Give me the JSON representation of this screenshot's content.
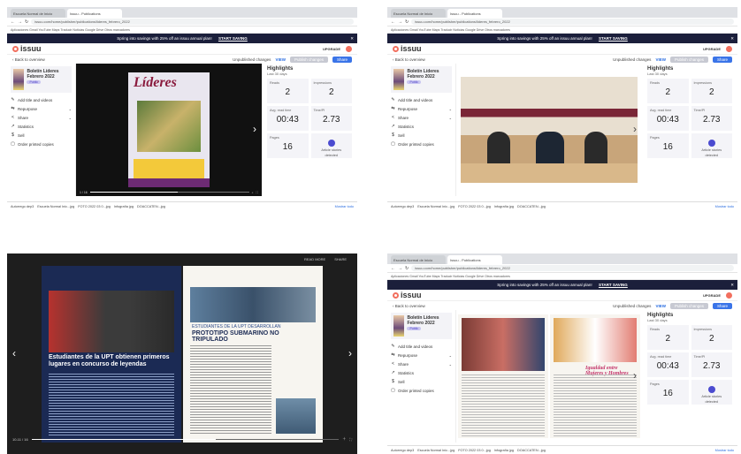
{
  "browser": {
    "tabs": [
      "Escuela Normal de Inicio",
      "Issuu - Publications"
    ],
    "address": "issuu.com/home/publisher/publications/lideres_febrero_2022",
    "bookmarks": "Aplicaciones   Gmail   YouTube   Maps   Traducir   Noticias   Google Drive   Otros marcadores"
  },
  "promo": {
    "text": "Spring into savings with 25% off an issuu annual plan!",
    "cta": "START SAVING",
    "close": "✕"
  },
  "issuu": {
    "logo": "issuu",
    "upgrade": "UPGRADE"
  },
  "subhead": {
    "back": "‹ Back to overview",
    "changes": "Unpublished changes",
    "view": "VIEW",
    "publish": "Publish changes",
    "share": "Share"
  },
  "publication": {
    "name": "Boletín Líderes Febrero 2022",
    "badge": "Public"
  },
  "menu": [
    {
      "icon": "✎",
      "label": "Add title and videos",
      "chev": ""
    },
    {
      "icon": "⇆",
      "label": "Repurpose",
      "chev": "⌄"
    },
    {
      "icon": "<",
      "label": "Share",
      "chev": "⌄"
    },
    {
      "icon": "↗",
      "label": "Statistics",
      "chev": ""
    },
    {
      "icon": "$",
      "label": "Sell",
      "chev": ""
    },
    {
      "icon": "▢",
      "label": "Order printed copies",
      "chev": ""
    }
  ],
  "viewer": {
    "cover_title": "Líderes",
    "page_label": "1 / 16",
    "pink_heading": "Igualdad entre Mujeres y Hombres",
    "next": "›",
    "prev": "‹"
  },
  "stats": {
    "title": "Highlights",
    "sub": "Last 30 days",
    "reads_label": "Reads",
    "reads": "2",
    "impressions_label": "Impressions",
    "impressions": "2",
    "avg_label": "Avg. read time",
    "avg": "00:43",
    "time_label": "Time/Pl",
    "time": "2.73",
    "pages_label": "Pages",
    "pages": "16",
    "articles_label": "Article stories",
    "articles": "detected"
  },
  "downloads": {
    "items": [
      "Autorrego dep3",
      "Escuela Normal Inic...jpg",
      "FOTO 2022 03 0...jpg",
      "Infografía jpg",
      "DOACCATEN...jpg"
    ],
    "show_all": "Mostrar todo"
  },
  "fullscreen": {
    "top_left": "READ MORE",
    "top_right": "SHARE",
    "left_headline": "Estudiantes de la UPT obtienen primeros lugares en concurso de leyendas",
    "right_kicker": "ESTUDIANTES DE LA UPT DESARROLLAN",
    "right_headline": "PROTOTIPO SUBMARINO NO TRIPULADO",
    "page_label": "10-11 / 16"
  },
  "progress": {
    "viewer": 0.55,
    "fullscreen": 0.6
  }
}
